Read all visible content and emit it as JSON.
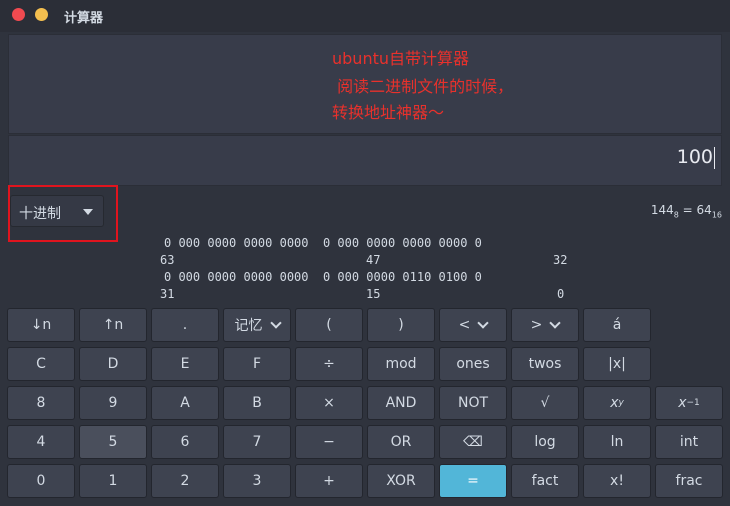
{
  "window": {
    "title": "计算器"
  },
  "annotation": {
    "line1": "ubuntu自带计算器",
    "line2": " 阅读二进制文件的时候，",
    "line3": "转换地址神器～"
  },
  "display": {
    "value": "100"
  },
  "base_selector": {
    "selected": "十进制"
  },
  "conversion": {
    "oct_value": "144",
    "oct_base": "8",
    "eq": " = ",
    "hex_value": "64",
    "hex_base": "16"
  },
  "bit_panel": {
    "row1_bits": "0 000 0000 0000 0000  0 000 0000 0000 0000 0",
    "row1_index_left": "63",
    "row1_index_mid": "47",
    "row1_index_right": "32",
    "row2_bits": "0 000 0000 0000 0000  0 000 0000 0110 0100 0",
    "row2_index_left": "31",
    "row2_index_mid": "15",
    "row2_index_right": "0"
  },
  "keypad": {
    "row1": [
      "↓n",
      "↑n",
      ".",
      "记忆",
      "(",
      ")",
      "<",
      ">",
      "á"
    ],
    "row2": [
      "C",
      "D",
      "E",
      "F",
      "÷",
      "mod",
      "ones",
      "twos",
      "|x|"
    ],
    "row3": [
      "8",
      "9",
      "A",
      "B",
      "×",
      "AND",
      "NOT",
      "√",
      "x",
      "y",
      "x",
      "−1"
    ],
    "row4": [
      "4",
      "5",
      "6",
      "7",
      "−",
      "OR",
      "⌫",
      "log",
      "ln",
      "int"
    ],
    "row5": [
      "0",
      "1",
      "2",
      "3",
      "+",
      "XOR",
      "=",
      "fact",
      "x!",
      "frac"
    ]
  },
  "colors": {
    "accent": "#52b6d8",
    "annotation": "#e8312c",
    "highlight_box": "#e0141e"
  }
}
